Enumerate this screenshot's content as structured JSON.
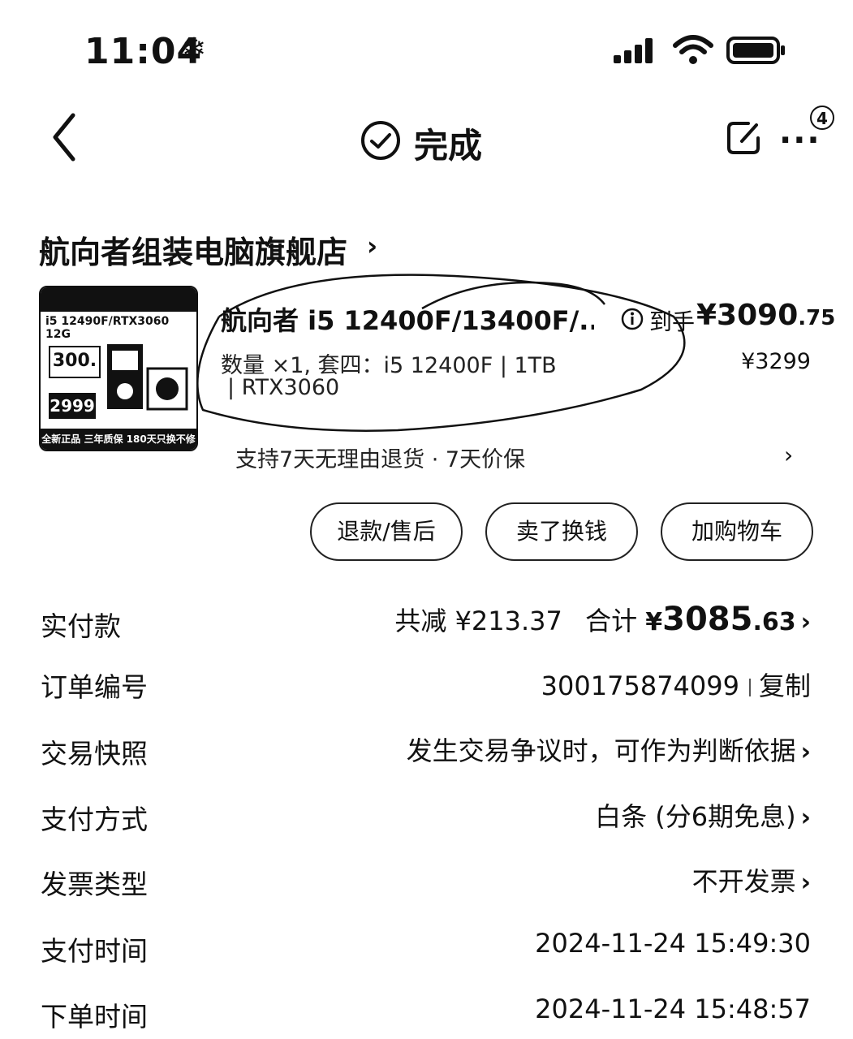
{
  "status_bar": {
    "time": "11:04",
    "snow_glyph": "❄",
    "icons": [
      "signal-icon",
      "wifi-icon",
      "battery-icon"
    ]
  },
  "nav": {
    "title": "完成",
    "more_label": "···",
    "badge": "4"
  },
  "shop": {
    "name": "航向者组装电脑旗舰店",
    "chevron": "›"
  },
  "product": {
    "thumbnail": {
      "sub": "i5 12490F/RTX3060 12G",
      "box1": "300.",
      "box2": "2999",
      "bottom": "全新正品 三年质保 180天只换不修"
    },
    "title": "航向者 i5 12400F/13400F/...",
    "spec_line1": "数量 ×1, 套四：i5 12400F | 1TB",
    "spec_line2": "| RTX3060",
    "price_label": "到手",
    "price_main": "¥3090",
    "price_decimal": ".75",
    "original_price": "¥3299",
    "policy": "支持7天无理由退货 · 7天价保",
    "policy_chevron": "›"
  },
  "actions": [
    "退款/售后",
    "卖了换钱",
    "加购物车"
  ],
  "details": {
    "paid": {
      "label": "实付款",
      "discount": "共减 ¥213.37",
      "total_label": "合计",
      "total_symbol": "¥",
      "total_int": "3085",
      "total_dec": ".63"
    },
    "order_no": {
      "label": "订单编号",
      "value": "300175874099",
      "copy": "复制"
    },
    "snapshot": {
      "label": "交易快照",
      "value": "发生交易争议时，可作为判断依据"
    },
    "payment": {
      "label": "支付方式",
      "value": "白条 (分6期免息)"
    },
    "invoice": {
      "label": "发票类型",
      "value": "不开发票"
    },
    "pay_time": {
      "label": "支付时间",
      "value": "2024-11-24 15:49:30"
    },
    "order_time": {
      "label": "下单时间",
      "value": "2024-11-24 15:48:57"
    },
    "chevron": "›"
  }
}
